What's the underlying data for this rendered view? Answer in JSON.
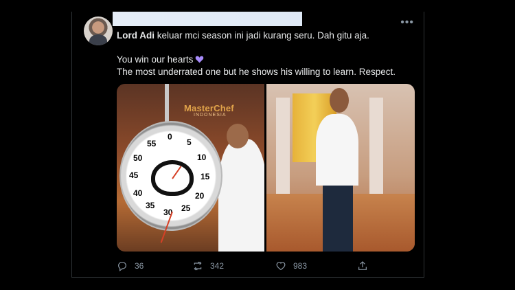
{
  "tweet": {
    "reply_name": "Lord Adi",
    "line1_rest": " keluar mci season ini jadi kurang seru. Dah gitu aja.",
    "line2": "You win our hearts",
    "heart_color": "#a78bfa",
    "line3": "The most underrated one but he shows his willing to learn. Respect."
  },
  "media": {
    "sign_title": "MasterChef",
    "sign_subtitle": "INDONESIA",
    "clock_numbers": [
      "0",
      "5",
      "10",
      "15",
      "20",
      "25",
      "30",
      "35",
      "40",
      "45",
      "50",
      "55"
    ]
  },
  "actions": {
    "replies": "36",
    "retweets": "342",
    "likes": "983"
  },
  "icons": {
    "more": "more-icon",
    "reply": "reply-icon",
    "retweet": "retweet-icon",
    "like": "like-icon",
    "share": "share-icon"
  }
}
